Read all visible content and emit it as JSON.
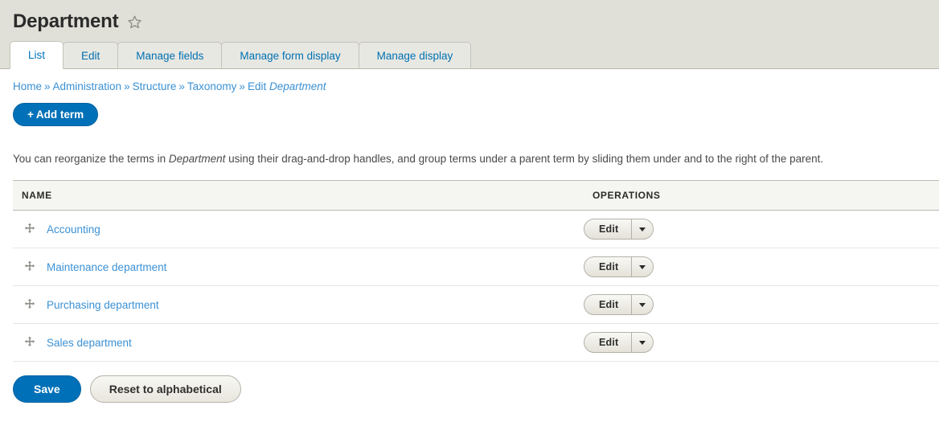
{
  "header": {
    "title": "Department",
    "star_icon": "star-outline-icon"
  },
  "tabs": [
    {
      "label": "List",
      "active": true
    },
    {
      "label": "Edit",
      "active": false
    },
    {
      "label": "Manage fields",
      "active": false
    },
    {
      "label": "Manage form display",
      "active": false
    },
    {
      "label": "Manage display",
      "active": false
    }
  ],
  "breadcrumb": {
    "separator": "»",
    "items": [
      {
        "label": "Home",
        "italic": false
      },
      {
        "label": "Administration",
        "italic": false
      },
      {
        "label": "Structure",
        "italic": false
      },
      {
        "label": "Taxonomy",
        "italic": false
      },
      {
        "label": "Edit ",
        "italic": false
      },
      {
        "label": "Department",
        "italic": true
      }
    ]
  },
  "action_links": {
    "add_term_plus": "+",
    "add_term_label": "Add term"
  },
  "help_text": {
    "part1": "You can reorganize the terms in ",
    "emphasis": "Department",
    "part2": " using their drag-and-drop handles, and group terms under a parent term by sliding them under and to the right of the parent."
  },
  "table": {
    "columns": {
      "name": "NAME",
      "operations": "OPERATIONS"
    },
    "rows": [
      {
        "drag_icon": "move-handle-icon",
        "name": "Accounting",
        "op_label": "Edit",
        "op_toggle": "chevron-down-icon"
      },
      {
        "drag_icon": "move-handle-icon",
        "name": "Maintenance department",
        "op_label": "Edit",
        "op_toggle": "chevron-down-icon"
      },
      {
        "drag_icon": "move-handle-icon",
        "name": "Purchasing department",
        "op_label": "Edit",
        "op_toggle": "chevron-down-icon"
      },
      {
        "drag_icon": "move-handle-icon",
        "name": "Sales department",
        "op_label": "Edit",
        "op_toggle": "chevron-down-icon"
      }
    ]
  },
  "form_actions": {
    "save_label": "Save",
    "reset_label": "Reset to alphabetical"
  },
  "colors": {
    "header_bg": "#e0e0d8",
    "link_blue": "#3b91d4",
    "tab_link_blue": "#0074bd",
    "primary_button": "#0071b8",
    "table_header_bg": "#f5f5f1",
    "row_border": "#e6e6e0"
  }
}
